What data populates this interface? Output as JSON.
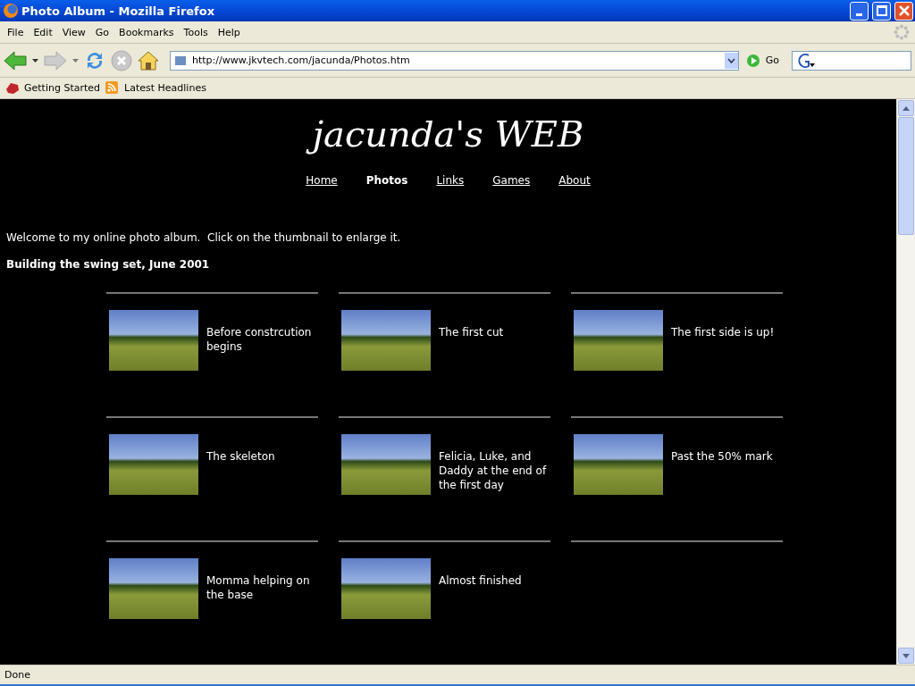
{
  "window": {
    "title": "Photo Album - Mozilla Firefox"
  },
  "menu": [
    "File",
    "Edit",
    "View",
    "Go",
    "Bookmarks",
    "Tools",
    "Help"
  ],
  "toolbar": {
    "url": "http://www.jkvtech.com/jacunda/Photos.htm",
    "go_label": "Go"
  },
  "bookmarks": [
    "Getting Started",
    "Latest Headlines"
  ],
  "page": {
    "site_title": "jacunda's WEB",
    "nav": [
      {
        "label": "Home",
        "selected": false
      },
      {
        "label": "Photos",
        "selected": true
      },
      {
        "label": "Links",
        "selected": false
      },
      {
        "label": "Games",
        "selected": false
      },
      {
        "label": "About",
        "selected": false
      }
    ],
    "intro": "Welcome to my online photo album.  Click on the thumbnail to enlarge it.",
    "section_title": "Building the swing set, June 2001",
    "photos": [
      {
        "caption": "Before constrcution begins"
      },
      {
        "caption": "The first cut"
      },
      {
        "caption": "The first side is up!"
      },
      {
        "caption": "The skeleton"
      },
      {
        "caption": "Felicia, Luke, and Daddy at the end of the first day"
      },
      {
        "caption": "Past the 50% mark"
      },
      {
        "caption": "Momma helping on the base"
      },
      {
        "caption": "Almost finished"
      }
    ]
  },
  "status_bar": "Done"
}
